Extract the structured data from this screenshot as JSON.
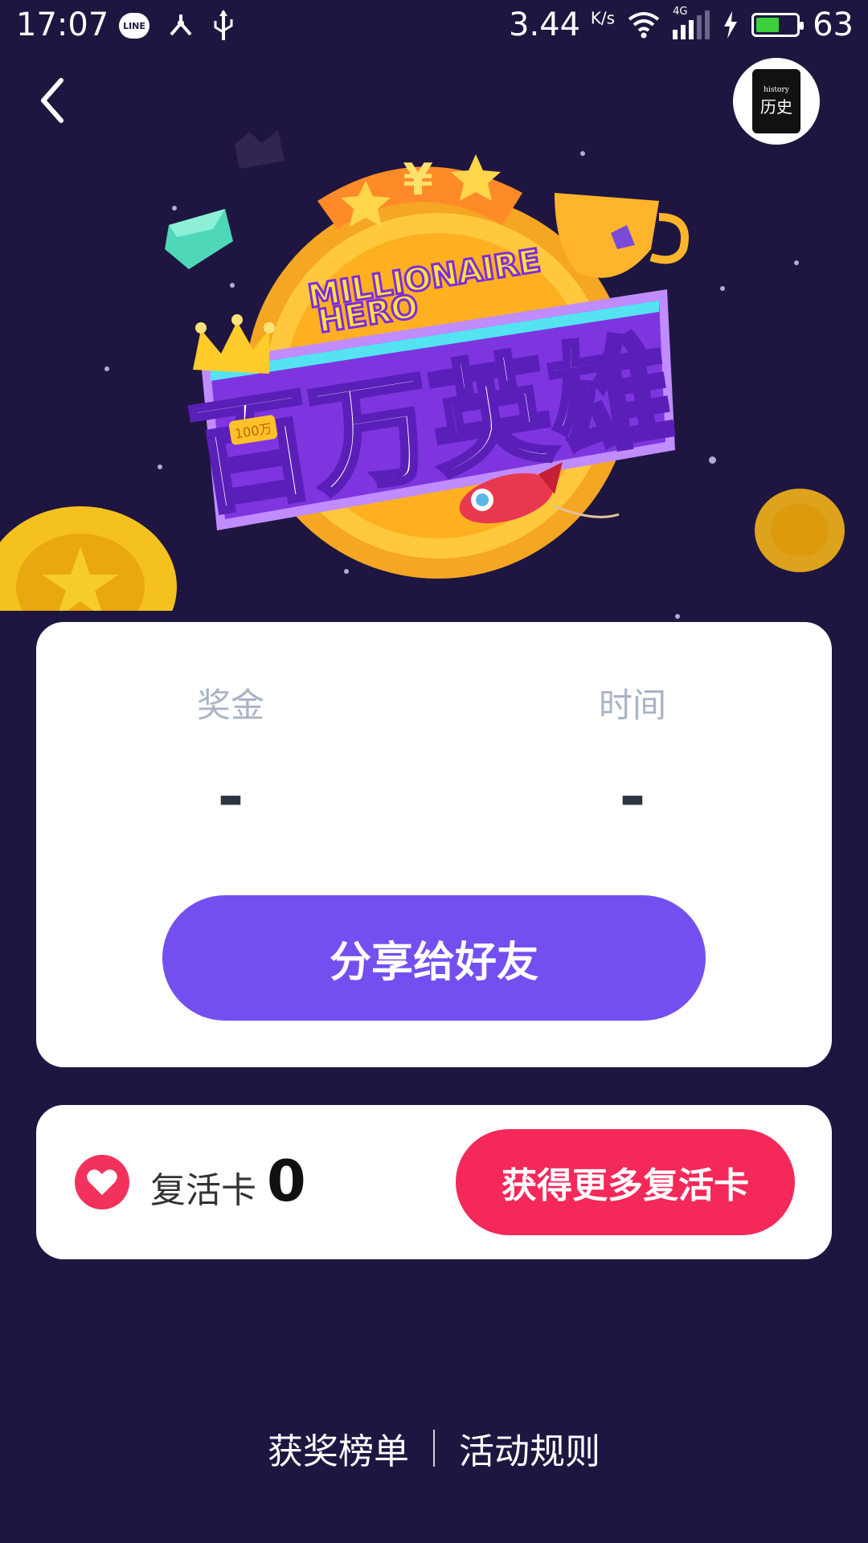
{
  "status_bar": {
    "time": "17:07",
    "line_label": "LINE",
    "speed": "3.44",
    "speed_unit": "K/s",
    "network": "4G",
    "battery_level": 63,
    "battery_text": "63",
    "battery_color": "#3ad13a"
  },
  "header": {
    "back_icon": "chevron-left-icon",
    "avatar": {
      "small_text": "history",
      "big_text": "历史"
    }
  },
  "hero": {
    "title_en_line1": "MILLIONAIRE",
    "title_en_line2": "HERO",
    "title_zh": "百万英雄",
    "coin_tag": "100万",
    "yuan_symbol": "¥"
  },
  "stats": {
    "prize_label": "奖金",
    "prize_value": "-",
    "time_label": "时间",
    "time_value": "-",
    "share_button": "分享给好友"
  },
  "revive": {
    "label": "复活卡",
    "count": "0",
    "more_button": "获得更多复活卡"
  },
  "footer": {
    "leaderboard": "获奖榜单",
    "rules": "活动规则"
  },
  "colors": {
    "background": "#1e1640",
    "share_button": "#744ff0",
    "more_button": "#f5285a",
    "heart": "#f2325d"
  }
}
